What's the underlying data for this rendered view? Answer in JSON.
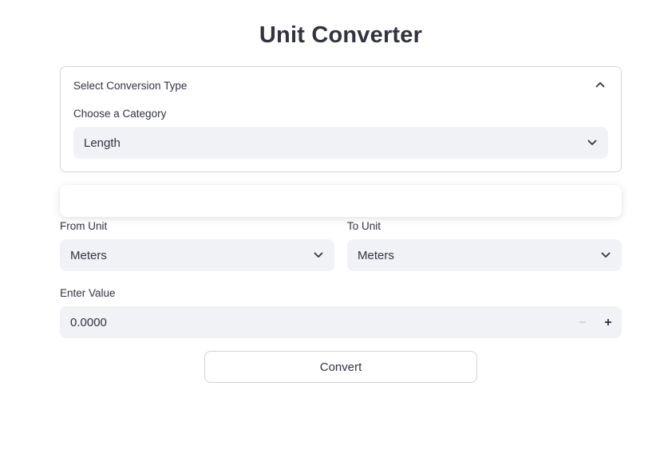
{
  "title": "Unit Converter",
  "expander": {
    "title": "Select Conversion Type",
    "category_label": "Choose a Category",
    "category_value": "Length"
  },
  "from_unit": {
    "label": "From Unit",
    "value": "Meters"
  },
  "to_unit": {
    "label": "To Unit",
    "value": "Meters"
  },
  "enter_value": {
    "label": "Enter Value",
    "value": "0.0000"
  },
  "convert_button": "Convert",
  "colors": {
    "text": "#31333f",
    "input_bg": "#f0f2f6",
    "border": "#d6d6d9"
  },
  "icons": {
    "collapse": "chevron-up-icon",
    "dropdown": "chevron-down-icon",
    "decrement": "minus-icon",
    "increment": "plus-icon"
  }
}
